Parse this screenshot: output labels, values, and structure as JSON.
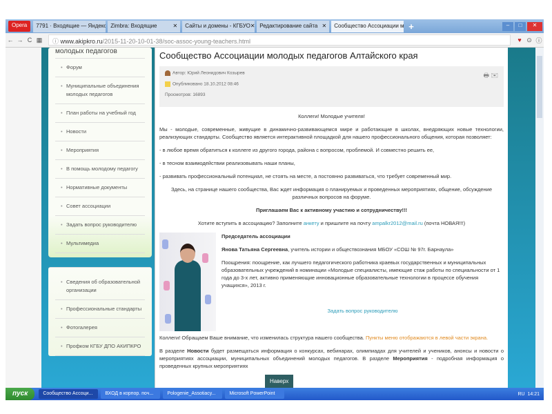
{
  "browser": {
    "name": "Opera",
    "tabs": [
      {
        "label": "7791 · Входящие — Яндекс"
      },
      {
        "label": "Zimbra: Входящие"
      },
      {
        "label": "Сайты и домены - КГБУО"
      },
      {
        "label": "Редактирование сайта"
      },
      {
        "label": "Сообщество Ассоциации м"
      }
    ],
    "new_tab": "+",
    "url_host": "www.akipkro.ru",
    "url_path": "/2015-11-20-10-01-38/soc-assoc-young-teachers.html"
  },
  "sidebar": {
    "heading": "молодых педагогов",
    "items": [
      "Форум",
      "Муниципальные объединения молодых педагогов",
      "План работы на учебный год",
      "Новости",
      "Мероприятия",
      "В помощь молодому педагогу",
      "Нормативные документы",
      "Совет ассоциации",
      "Задать вопрос руководителю",
      "Мультимедиа"
    ],
    "items2": [
      "Сведения об образовательной организации",
      "Профессиональные стандарты",
      "Фотогалерея",
      "Профком КГБУ ДПО АКИПКРО"
    ]
  },
  "article": {
    "title": "Сообщество Ассоциации молодых педагогов Алтайского края",
    "author": "Автор: Юрий Леонидович Козырев",
    "published": "Опубликовано 18.10.2012 08:46",
    "views": "Просмотров: 16893",
    "greeting": "Коллеги! Молодые учителя!",
    "intro": "Мы - молодые, современные, живущие в динамично-развивающемся мире и работающие в школах, внедряющих новые технологии, реализующих стандарты. Сообщество является интерактивной площадкой для нашего профессионального общения, которая позволяет:",
    "bullets": [
      "- в любое время обратиться к коллеге из другого города, района с вопросом, проблемой. И совместно решить ее,",
      "- в тесном взаимодействии реализовывать наши планы,",
      "- развивать профессиональный потенциал, не стоять на месте, а постоянно развиваться, что требует современный мир."
    ],
    "here": "Здесь, на странице нашего сообщества, Вас ждет информация о планируемых и проведенных мероприятиях, общение, обсуждение различных вопросов на форуме.",
    "invite": "Приглашаем Вас к активному участию и сотрудничеству!!!",
    "join_pre": "Хотите вступить в ассоциацию? Заполните ",
    "join_link": "анкету",
    "join_mid": " и пришлите на почту ",
    "join_email": "ampalkr2012@mail.ru",
    "join_post": " (почта НОВАЯ!!!)",
    "chair_heading": "Председатель ассоциации",
    "chair_name": "Янова Татьяна Сергеевна",
    "chair_role": ", учитель истории и обществознания МБОУ «СОШ № 97г. Барнаула»",
    "chair_award": "Поощрения: поощрение, как лучшего педагогического работника краевых государственных и муниципальных образовательных учреждений в номинации «Молодые специалисты, имеющие стаж работы по специальности от 1 года до 3-х лет, активно применяющие инновационные образовательные технологии в процессе обучения учащихся», 2013 г.",
    "ask_link": "Задать вопрос руководителю",
    "notice": "Коллеги! Обращаем Ваше внимание, что изменилась структура нашего сообщества. ",
    "notice_hl": "Пункты меню отображаются в левой части экрана.",
    "news_pre": "В разделе ",
    "news_b": "Новости",
    "news_text": " будет размещаться информация о конкурсах, вебинарах, олимпиадах для учителей и учеников, анонсы и новости о мероприятиях ассоциации, муниципальных объединений молодых педагогов. В разделе ",
    "events_b": "Мероприятия",
    "events_text": " - подробная информация о проведенных крупных мероприятиях"
  },
  "to_top": "Наверх",
  "taskbar": {
    "start": "пуск",
    "items": [
      "Сообщество Ассоци...",
      "ВХОД в корпор. поч...",
      "Pologenie_Assotiacy...",
      "Microsoft PowerPoint"
    ],
    "lang": "RU",
    "time": "14:21"
  }
}
